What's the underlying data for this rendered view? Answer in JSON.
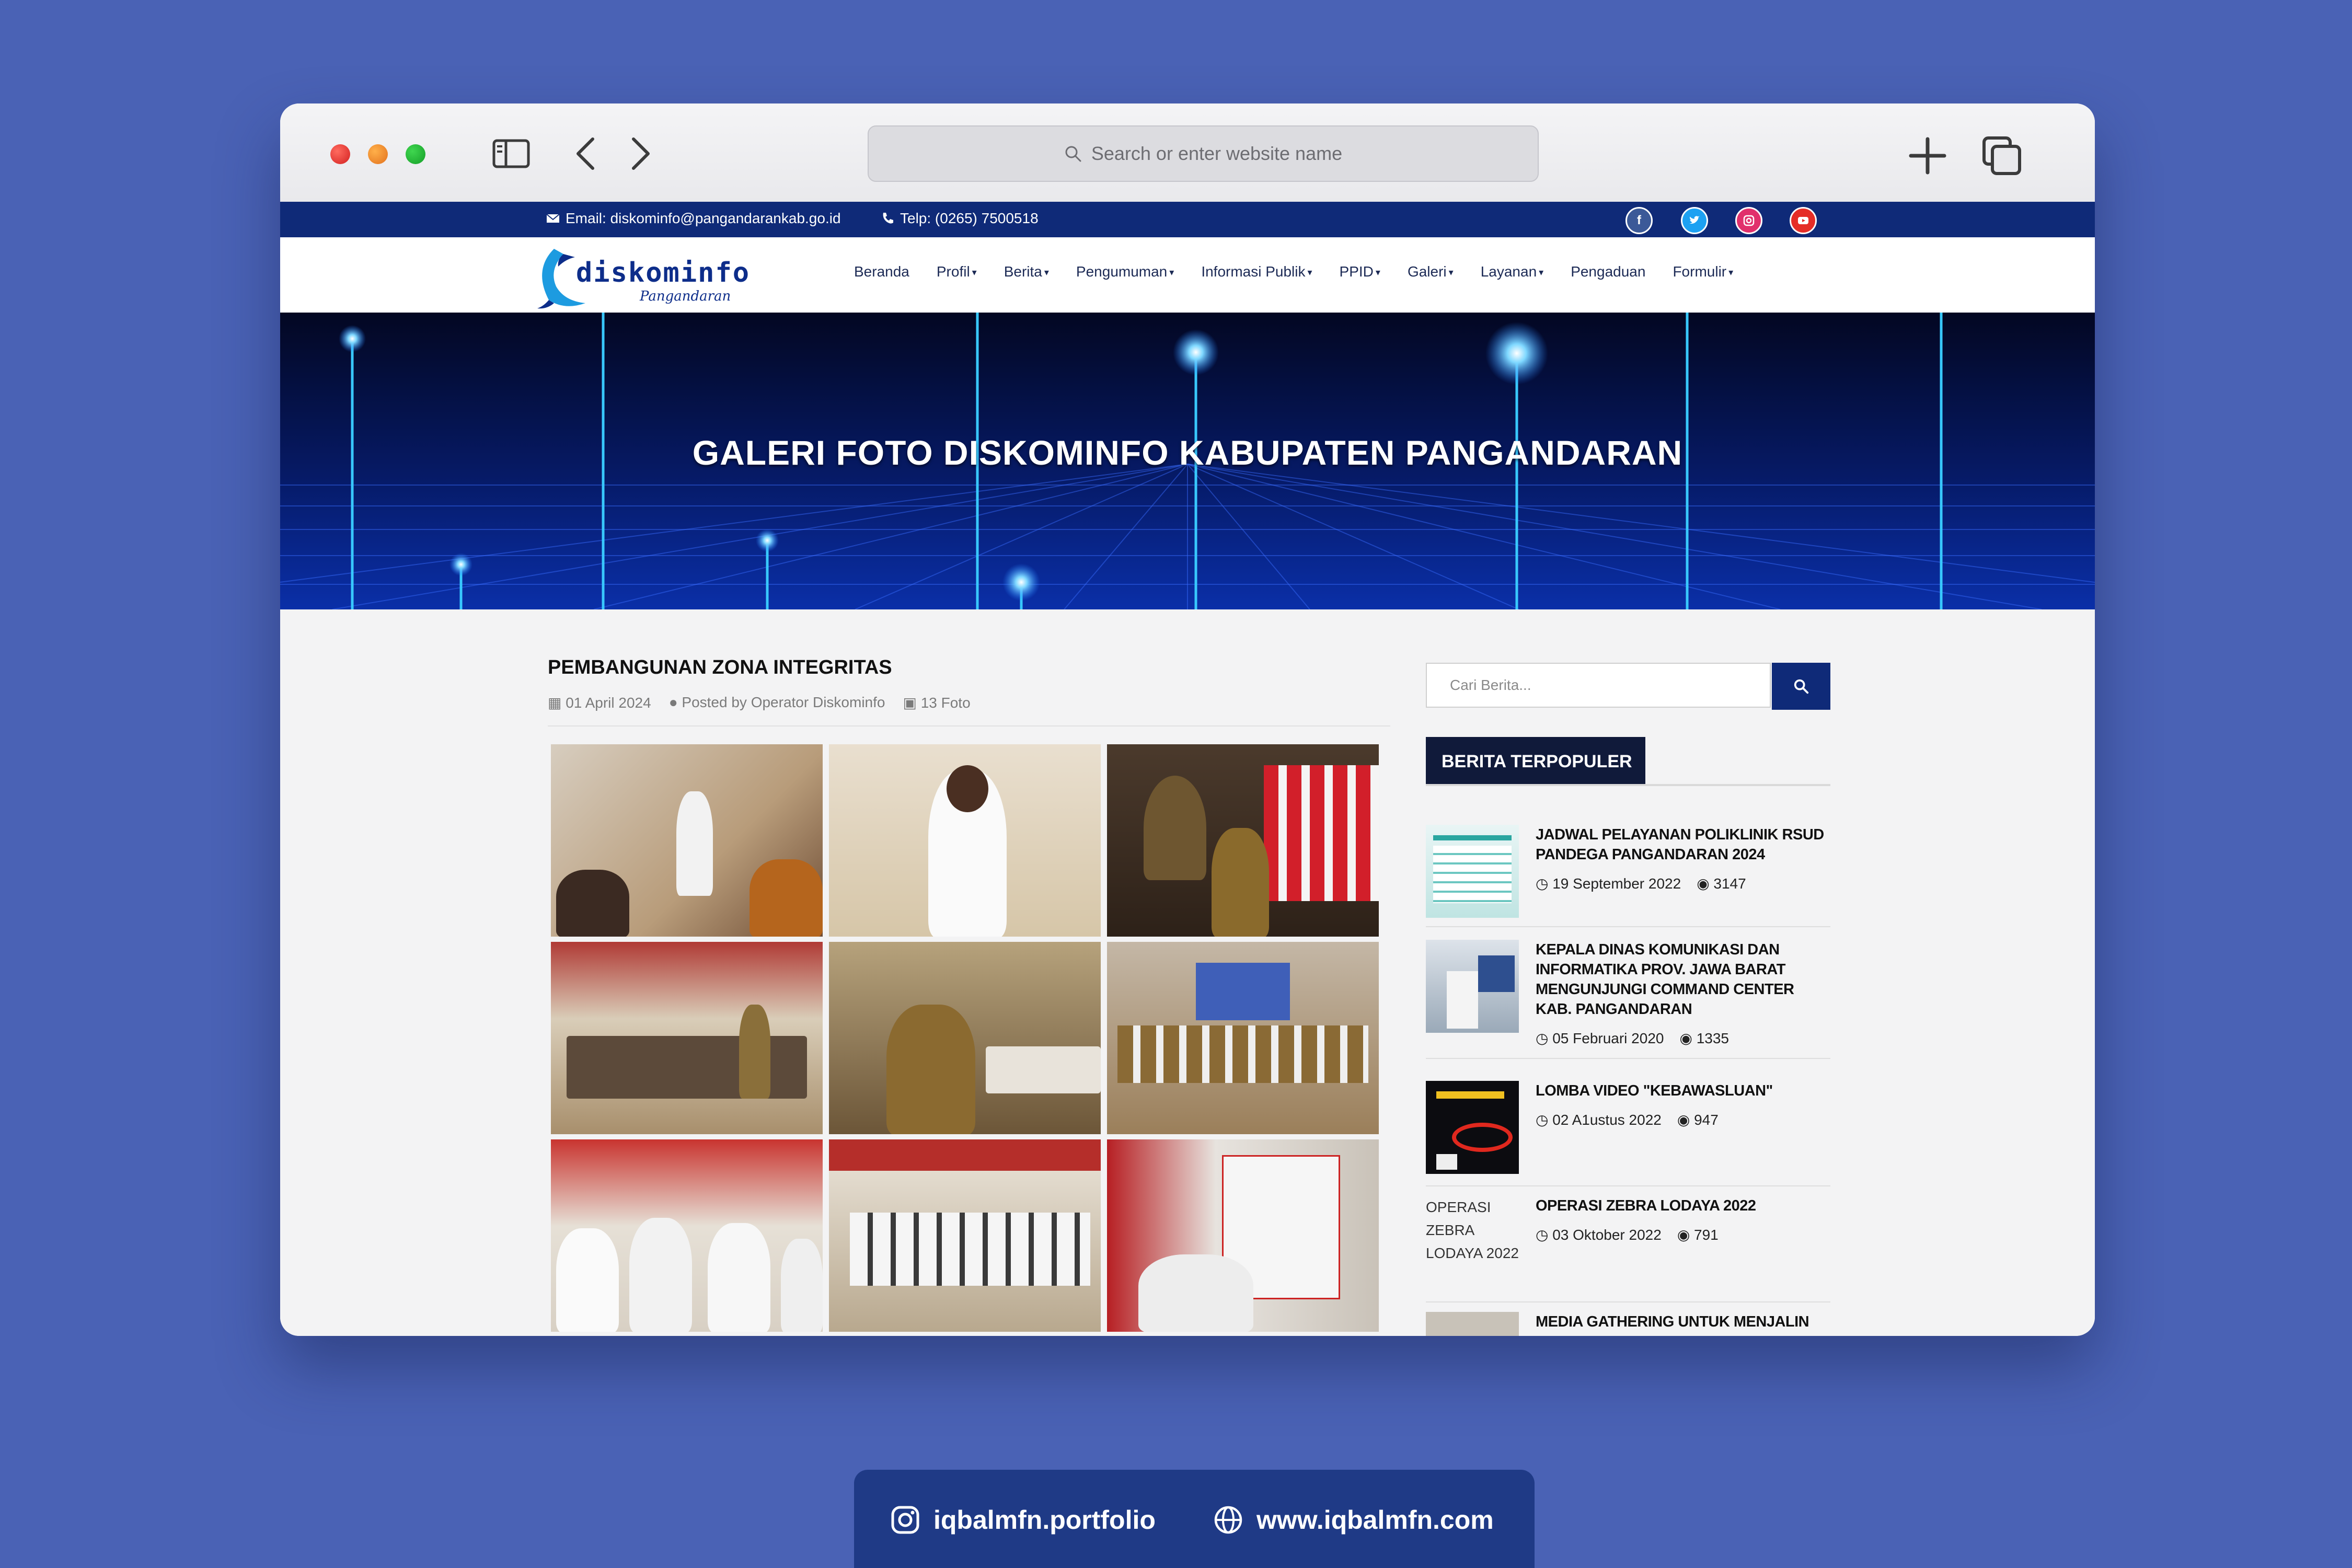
{
  "browser": {
    "address_placeholder": "Search or enter website name"
  },
  "topbar": {
    "email_label": "Email: diskominfo@pangandarankab.go.id",
    "phone_label": "Telp: (0265) 7500518",
    "social": [
      "facebook-icon",
      "twitter-icon",
      "instagram-icon",
      "youtube-icon"
    ]
  },
  "site": {
    "logo_text": "diskominfo",
    "logo_sub": "Pangandaran"
  },
  "menu": [
    {
      "label": "Beranda",
      "dropdown": false
    },
    {
      "label": "Profil",
      "dropdown": true
    },
    {
      "label": "Berita",
      "dropdown": true
    },
    {
      "label": "Pengumuman",
      "dropdown": true
    },
    {
      "label": "Informasi Publik",
      "dropdown": true
    },
    {
      "label": "PPID",
      "dropdown": true
    },
    {
      "label": "Galeri",
      "dropdown": true
    },
    {
      "label": "Layanan",
      "dropdown": true
    },
    {
      "label": "Pengaduan",
      "dropdown": false
    },
    {
      "label": "Formulir",
      "dropdown": true
    }
  ],
  "hero": {
    "title": "GALERI FOTO DISKOMINFO KABUPATEN PANGANDARAN"
  },
  "article": {
    "title": "PEMBANGUNAN ZONA INTEGRITAS",
    "date": "01 April 2024",
    "author": "Posted by Operator Diskominfo",
    "photo_count": "13 Foto"
  },
  "search": {
    "placeholder": "Cari Berita..."
  },
  "popular": {
    "heading": "BERITA TERPOPULER",
    "items": [
      {
        "title": "JADWAL PELAYANAN POLIKLINIK RSUD PANDEGA PANGANDARAN 2024",
        "date": "19 September 2022",
        "views": "3147"
      },
      {
        "title": "KEPALA DINAS KOMUNIKASI DAN INFORMATIKA PROV. JAWA BARAT MENGUNJUNGI COMMAND CENTER KAB. PANGANDARAN",
        "date": "05 Februari 2020",
        "views": "1335"
      },
      {
        "title": "LOMBA VIDEO \"KEBAWASLUAN\"",
        "date": "02 A1ustus 2022",
        "views": "947"
      },
      {
        "title": "OPERASI ZEBRA LODAYA 2022",
        "date": "03 Oktober 2022",
        "views": "791",
        "alt": "OPERASI ZEBRA LODAYA 2022"
      },
      {
        "title": "MEDIA GATHERING UNTUK MENJALIN"
      }
    ]
  },
  "footer": {
    "instagram": "iqbalmfn.portfolio",
    "website": "www.iqbalmfn.com"
  },
  "colors": {
    "background": "#4a62b5",
    "topbar": "#0f2a78",
    "accent": "#0f2a78",
    "popular_head": "#101a3a"
  }
}
